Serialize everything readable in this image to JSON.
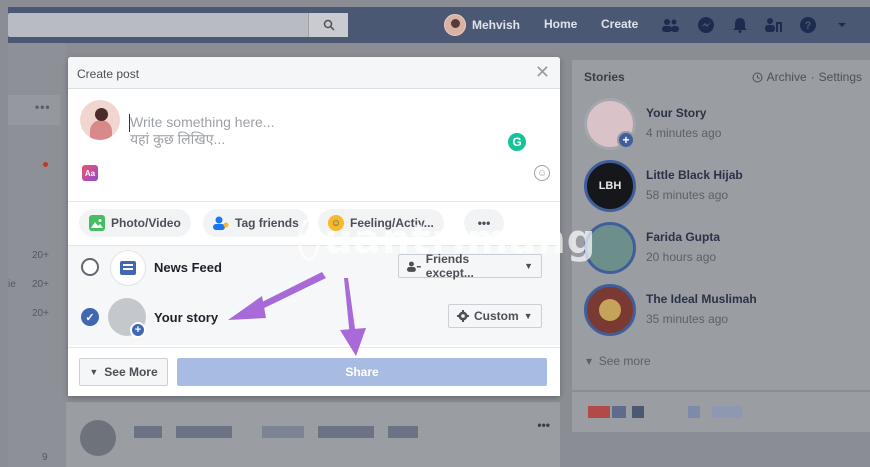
{
  "topbar": {
    "user_name": "Mehvish",
    "nav": [
      "Home",
      "Create"
    ]
  },
  "modal": {
    "title": "Create post",
    "placeholder_en": "Write something here...",
    "placeholder_hi": "यहां कुछ लिखिए...",
    "actions": [
      "Photo/Video",
      "Tag friends",
      "Feeling/Activ..."
    ],
    "audience": [
      {
        "label": "News Feed",
        "dropdown": "Friends except...",
        "checked": false
      },
      {
        "label": "Your story",
        "dropdown": "Custom",
        "checked": true
      }
    ],
    "see_more": "See More",
    "share": "Share"
  },
  "stories": {
    "title": "Stories",
    "archive": "Archive",
    "settings": "Settings",
    "items": [
      {
        "name": "Your Story",
        "time": "4 minutes ago"
      },
      {
        "name": "Little Black Hijab",
        "time": "58 minutes ago",
        "avatar_text": "LBH"
      },
      {
        "name": "Farida Gupta",
        "time": "20 hours ago"
      },
      {
        "name": "The Ideal Muslimah",
        "time": "35 minutes ago"
      }
    ],
    "see_more": "See more"
  },
  "left_numbers": [
    "20+",
    "20+",
    "20+",
    "9"
  ],
  "left_partial": "ie",
  "watermark": "uantrimang",
  "colors": {
    "topbar": "#4b5874",
    "accent": "#4267b2",
    "share_disabled": "#a8bce3",
    "arrow": "#a86ad8"
  }
}
